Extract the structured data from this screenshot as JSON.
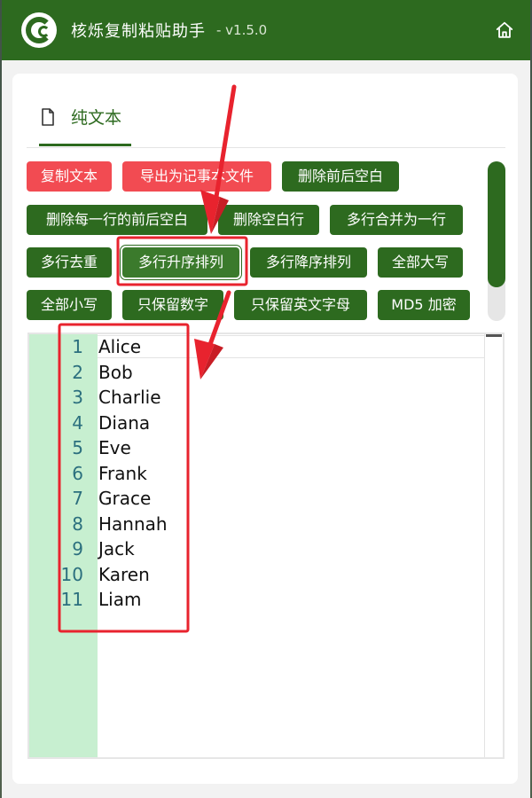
{
  "app": {
    "title": "核烁复制粘贴助手",
    "version": "- v1.5.0",
    "home_icon": "home-icon",
    "logo_icon": "cc-logo-icon"
  },
  "tab": {
    "icon": "document-icon",
    "label": "纯文本"
  },
  "toolbar": {
    "buttons": [
      {
        "label": "复制文本",
        "style": "red"
      },
      {
        "label": "导出为记事本文件",
        "style": "red"
      },
      {
        "label": "删除前后空白",
        "style": "green"
      },
      {
        "label": "删除每一行的前后空白",
        "style": "green"
      },
      {
        "label": "删除空白行",
        "style": "green"
      },
      {
        "label": "多行合并为一行",
        "style": "green"
      },
      {
        "label": "多行去重",
        "style": "green"
      },
      {
        "label": "多行升序排列",
        "style": "green-selected"
      },
      {
        "label": "多行降序排列",
        "style": "green"
      },
      {
        "label": "全部大写",
        "style": "green"
      },
      {
        "label": "全部小写",
        "style": "green"
      },
      {
        "label": "只保留数字",
        "style": "green"
      },
      {
        "label": "只保留英文字母",
        "style": "green"
      },
      {
        "label": "MD5 加密",
        "style": "green"
      }
    ]
  },
  "editor": {
    "lines": [
      {
        "num": "1",
        "text": "Alice"
      },
      {
        "num": "2",
        "text": "Bob"
      },
      {
        "num": "3",
        "text": "Charlie"
      },
      {
        "num": "4",
        "text": "Diana"
      },
      {
        "num": "5",
        "text": "Eve"
      },
      {
        "num": "6",
        "text": "Frank"
      },
      {
        "num": "7",
        "text": "Grace"
      },
      {
        "num": "8",
        "text": "Hannah"
      },
      {
        "num": "9",
        "text": "Jack"
      },
      {
        "num": "10",
        "text": "Karen"
      },
      {
        "num": "11",
        "text": "Liam"
      }
    ]
  },
  "colors": {
    "brand_green": "#2d6a1f",
    "danger_red": "#f24b52",
    "gutter_green": "#c7efd0",
    "line_number": "#2b6f7e",
    "annotation_red": "#e8232e"
  }
}
